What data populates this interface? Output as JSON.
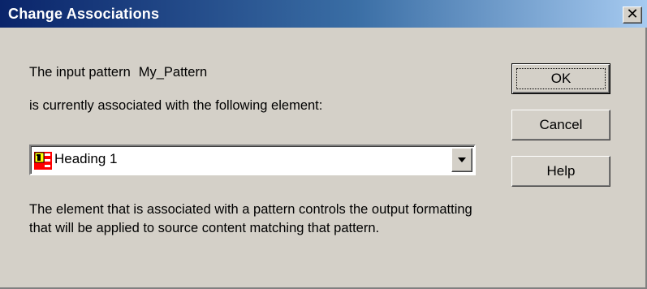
{
  "window": {
    "title": "Change Associations",
    "close_symbol": "✕"
  },
  "content": {
    "input_pattern_prefix": "The input pattern",
    "input_pattern_name": "My_Pattern",
    "association_text": "is currently associated with the following element:",
    "description": "The element that is associated with a pattern controls the output formatting that will be applied to source content matching that pattern."
  },
  "element_select": {
    "selected_value": "Heading 1",
    "icon": "heading-element-icon",
    "dropdown_icon": "chevron-down-icon"
  },
  "buttons": {
    "ok": "OK",
    "cancel": "Cancel",
    "help": "Help"
  },
  "colors": {
    "titlebar_start": "#0a246a",
    "titlebar_end": "#a6caf0",
    "dialog_bg": "#d4d0c8",
    "icon_red": "#ff0000",
    "icon_yellow": "#ffff00"
  }
}
